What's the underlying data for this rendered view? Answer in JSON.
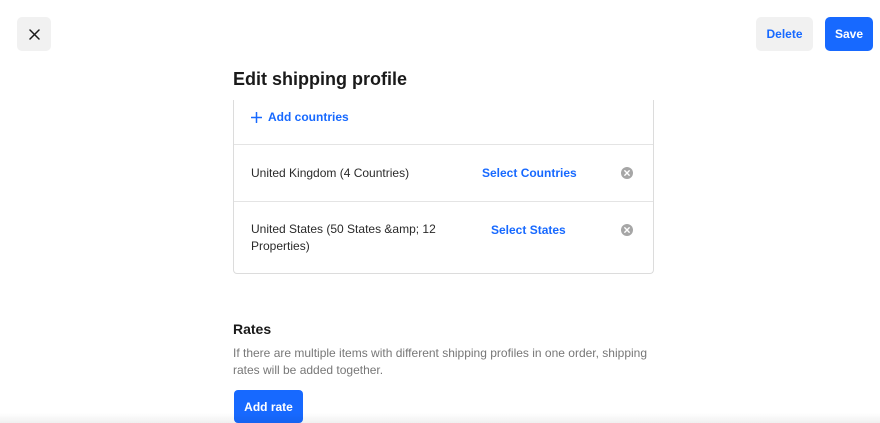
{
  "header": {
    "close_icon": "close-icon",
    "delete_label": "Delete",
    "save_label": "Save"
  },
  "page": {
    "title": "Edit shipping profile"
  },
  "regions": {
    "add_countries_label": "Add countries",
    "add_icon": "plus-icon",
    "rows": [
      {
        "name": "United Kingdom (4 Countries)",
        "action_label": "Select Countries",
        "remove_icon": "remove-circle-icon"
      },
      {
        "name": "United States (50 States &amp; 12 Properties)",
        "action_label": "Select States",
        "remove_icon": "remove-circle-icon"
      }
    ]
  },
  "rates": {
    "heading": "Rates",
    "description": "If there are multiple items with different shipping profiles in one order, shipping rates will be added together.",
    "add_rate_label": "Add rate"
  },
  "colors": {
    "accent": "#1769ff",
    "button_secondary_bg": "#f1f1f1",
    "muted_text": "#777777",
    "remove_icon": "#a6a6a6"
  }
}
